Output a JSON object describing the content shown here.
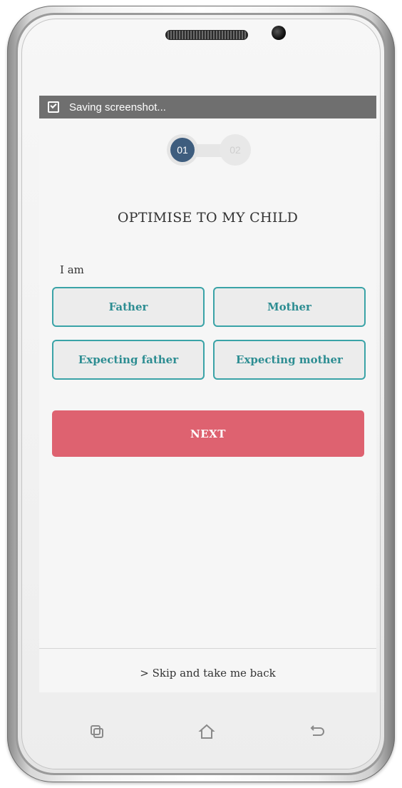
{
  "status_bar": {
    "icon": "screenshot-icon",
    "text": "Saving screenshot..."
  },
  "stepper": {
    "steps": [
      {
        "label": "01",
        "active": true
      },
      {
        "label": "02",
        "active": false
      }
    ]
  },
  "header": {
    "title": "OPTIMISE TO MY CHILD"
  },
  "form": {
    "prompt": "I am",
    "options": [
      {
        "label": "Father"
      },
      {
        "label": "Mother"
      },
      {
        "label": "Expecting father"
      },
      {
        "label": "Expecting mother"
      }
    ],
    "next_label": "NEXT"
  },
  "footer": {
    "skip_label": "> Skip and take me back"
  },
  "hardware_nav": [
    "recent-apps-icon",
    "home-icon",
    "back-icon"
  ],
  "colors": {
    "accent_teal": "#3aa3a7",
    "button_red": "#de6270",
    "step_active": "#3e5d7e",
    "status_bar": "#6f6f6f"
  }
}
